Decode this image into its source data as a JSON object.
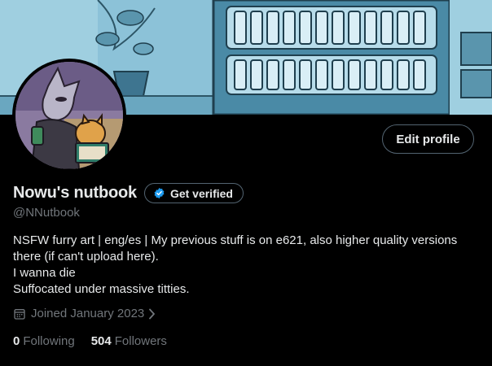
{
  "profile": {
    "display_name": "Nowu's nutbook",
    "handle": "@NNutbook",
    "edit_profile_label": "Edit profile",
    "get_verified_label": "Get verified",
    "bio_lines": [
      "NSFW furry art | eng/es | My previous stuff is on e621, also higher quality versions",
      "there (if can't upload here).",
      "I wanna die",
      "Suffocated under massive titties."
    ],
    "joined": "Joined January 2023",
    "following_count": "0",
    "following_label": "Following",
    "followers_count": "504",
    "followers_label": "Followers"
  },
  "colors": {
    "background": "#000000",
    "text": "#e7e9ea",
    "muted": "#71767b",
    "border": "#536471",
    "verified_blue": "#1d9bf0",
    "banner_blue": "#7fb7cf"
  },
  "icons": {
    "verified": "verified-badge-icon",
    "calendar": "calendar-icon",
    "chevron": "chevron-right-icon"
  }
}
